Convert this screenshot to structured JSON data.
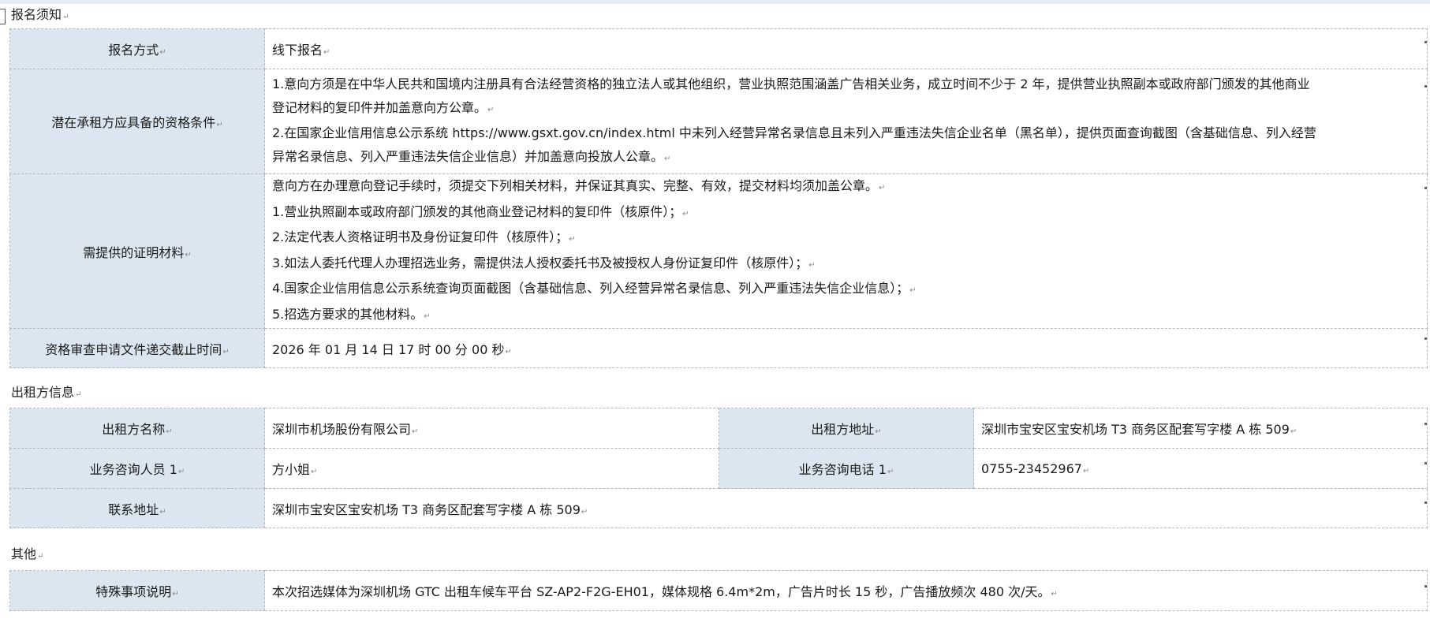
{
  "sections": {
    "notice_title": "报名须知",
    "lessor_title": "出租方信息",
    "other_title": "其他"
  },
  "para_mark": "↵",
  "notice": {
    "method_label": "报名方式",
    "method_value": "线下报名",
    "qual_label": "潜在承租方应具备的资格条件",
    "qual_line1": "1.意向方须是在中华人民共和国境内注册具有合法经营资格的独立法人或其他组织，营业执照范围涵盖广告相关业务，成立时间不少于 2 年，提供营业执照副本或政府部门颁发的其他商业",
    "qual_line2": "登记材料的复印件并加盖意向方公章。",
    "qual_line3": "2.在国家企业信用信息公示系统 https://www.gsxt.gov.cn/index.html 中未列入经营异常名录信息且未列入严重违法失信企业名单（黑名单），提供页面查询截图（含基础信息、列入经营",
    "qual_line4": "异常名录信息、列入严重违法失信企业信息）并加盖意向投放人公章。",
    "docs_label": "需提供的证明材料",
    "docs_lines": [
      "意向方在办理意向登记手续时，须提交下列相关材料，并保证其真实、完整、有效，提交材料均须加盖公章。",
      "1.营业执照副本或政府部门颁发的其他商业登记材料的复印件（核原件）；",
      "2.法定代表人资格证明书及身份证复印件（核原件）；",
      "3.如法人委托代理人办理招选业务，需提供法人授权委托书及被授权人身份证复印件（核原件）；",
      "4.国家企业信用信息公示系统查询页面截图（含基础信息、列入经营异常名录信息、列入严重违法失信企业信息）；",
      "5.招选方要求的其他材料。"
    ],
    "deadline_label": "资格审查申请文件递交截止时间",
    "deadline_value": "2026 年 01 月 14 日 17 时 00 分 00 秒"
  },
  "lessor": {
    "name_label": "出租方名称",
    "name_value": "深圳市机场股份有限公司",
    "addr_label": "出租方地址",
    "addr_value": "深圳市宝安区宝安机场 T3 商务区配套写字楼 A 栋 509",
    "contact_label": "业务咨询人员 1",
    "contact_value": "方小姐",
    "phone_label": "业务咨询电话 1",
    "phone_value": "0755-23452967",
    "contact_addr_label": "联系地址",
    "contact_addr_value": "深圳市宝安区宝安机场 T3 商务区配套写字楼 A 栋 509"
  },
  "other": {
    "special_label": "特殊事项说明",
    "special_value": "本次招选媒体为深圳机场 GTC 出租车候车平台 SZ-AP2-F2G-EH01，媒体规格 6.4m*2m，广告片时长 15 秒，广告播放频次 480 次/天。"
  }
}
